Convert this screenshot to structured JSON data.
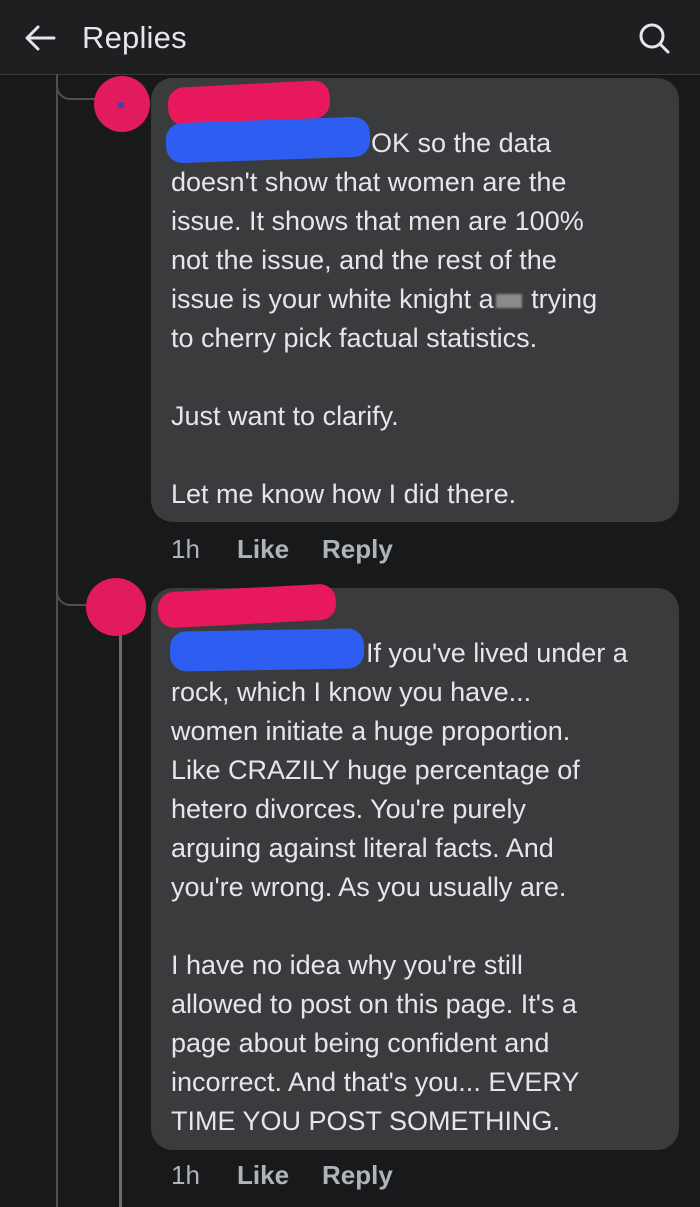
{
  "header": {
    "title": "Replies",
    "back_icon": "arrow-left-icon",
    "search_icon": "search-icon"
  },
  "colors": {
    "background": "#18191a",
    "bubble": "#3a3b3c",
    "redaction_pink": "#e8185c",
    "redaction_blue": "#2d5df1"
  },
  "comments": [
    {
      "lines": [
        "OK so the data",
        "doesn't show that women are the",
        "issue. It shows that men are 100%",
        "not the issue, and the rest of the",
        "issue is your white knight a",
        " trying",
        "to cherry pick factual statistics.",
        "Just want to clarify.",
        "Let me know how I did there."
      ],
      "time": "1h",
      "like_label": "Like",
      "reply_label": "Reply"
    },
    {
      "lines": [
        "If you've lived under a",
        "rock, which I know you have...",
        "women initiate a huge proportion.",
        "Like CRAZILY huge percentage of",
        "hetero divorces. You're purely",
        "arguing against literal facts. And",
        "you're wrong. As you usually are.",
        "I have no idea why you're still",
        "allowed to post on this page. It's a",
        "page about being confident and",
        "incorrect. And that's you... EVERY",
        "TIME YOU POST SOMETHING."
      ],
      "time": "1h",
      "like_label": "Like",
      "reply_label": "Reply"
    }
  ]
}
